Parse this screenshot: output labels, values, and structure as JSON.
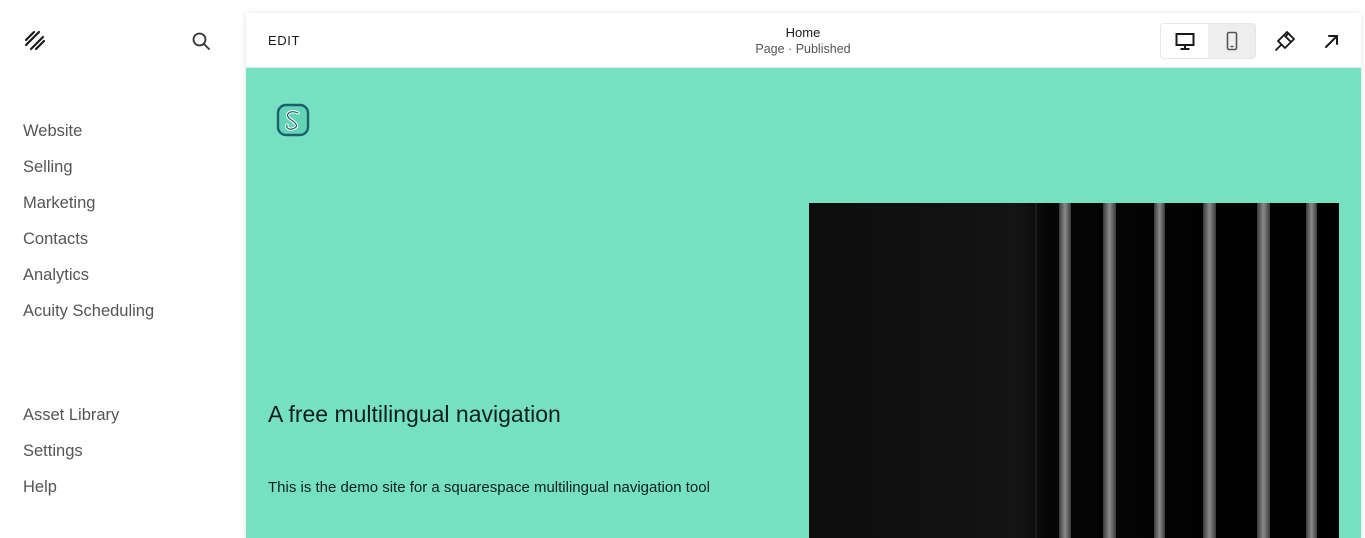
{
  "sidebar": {
    "primary_nav": [
      {
        "label": "Website"
      },
      {
        "label": "Selling"
      },
      {
        "label": "Marketing"
      },
      {
        "label": "Contacts"
      },
      {
        "label": "Analytics"
      },
      {
        "label": "Acuity Scheduling"
      }
    ],
    "secondary_nav": [
      {
        "label": "Asset Library"
      },
      {
        "label": "Settings"
      },
      {
        "label": "Help"
      }
    ],
    "icons": {
      "logo": "squarespace-logo-icon",
      "search": "search-icon"
    }
  },
  "toolbar": {
    "edit_label": "EDIT",
    "page_title": "Home",
    "page_status": "Page · Published",
    "active_device": "desktop",
    "icons": {
      "desktop": "desktop-icon",
      "mobile": "mobile-icon",
      "design": "paintbrush-icon",
      "open": "arrow-up-right-icon"
    }
  },
  "preview": {
    "heading": "A free multilingual navigation",
    "body": "This is the demo site for a squarespace multilingual navigation tool",
    "background_color": "#75e1c1"
  }
}
